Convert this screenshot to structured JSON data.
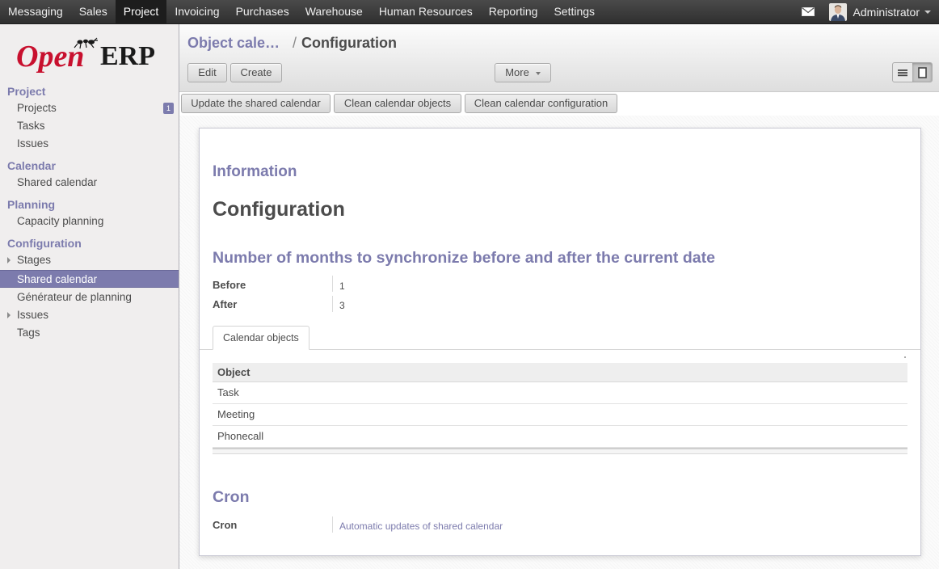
{
  "topbar": {
    "menu": [
      "Messaging",
      "Sales",
      "Project",
      "Invoicing",
      "Purchases",
      "Warehouse",
      "Human Resources",
      "Reporting",
      "Settings"
    ],
    "active": "Project",
    "user_name": "Administrator"
  },
  "logo": {
    "text_open": "Open",
    "text_erp": "ERP"
  },
  "sidebar": {
    "sections": [
      {
        "title": "Project",
        "items": [
          {
            "label": "Projects",
            "badge": "1"
          },
          {
            "label": "Tasks"
          },
          {
            "label": "Issues"
          }
        ]
      },
      {
        "title": "Calendar",
        "items": [
          {
            "label": "Shared calendar"
          }
        ]
      },
      {
        "title": "Planning",
        "items": [
          {
            "label": "Capacity planning"
          }
        ]
      },
      {
        "title": "Configuration",
        "items": [
          {
            "label": "Stages",
            "expandable": true
          },
          {
            "label": "Shared calendar",
            "active": true
          },
          {
            "label": "Générateur de planning"
          },
          {
            "label": "Issues",
            "expandable": true
          },
          {
            "label": "Tags"
          }
        ]
      }
    ]
  },
  "breadcrumb": {
    "parent": "Object cale…",
    "separator": "/",
    "current": "Configuration"
  },
  "toolbar": {
    "edit": "Edit",
    "create": "Create",
    "more": "More"
  },
  "header_buttons": [
    "Update the shared calendar",
    "Clean calendar objects",
    "Clean calendar configuration"
  ],
  "form": {
    "info_title": "Information",
    "name": "Configuration",
    "sync_title": "Number of months to synchronize before and after the current date",
    "before_label": "Before",
    "before_value": "1",
    "after_label": "After",
    "after_value": "3",
    "tab_label": "Calendar objects",
    "table": {
      "header": "Object",
      "rows": [
        "Task",
        "Meeting",
        "Phonecall"
      ]
    },
    "cron_title": "Cron",
    "cron_label": "Cron",
    "cron_value": "Automatic updates of shared calendar"
  },
  "colors": {
    "accent": "#7c7bad",
    "logo_red": "#c8102e",
    "topbar": "#3a3a3a"
  }
}
